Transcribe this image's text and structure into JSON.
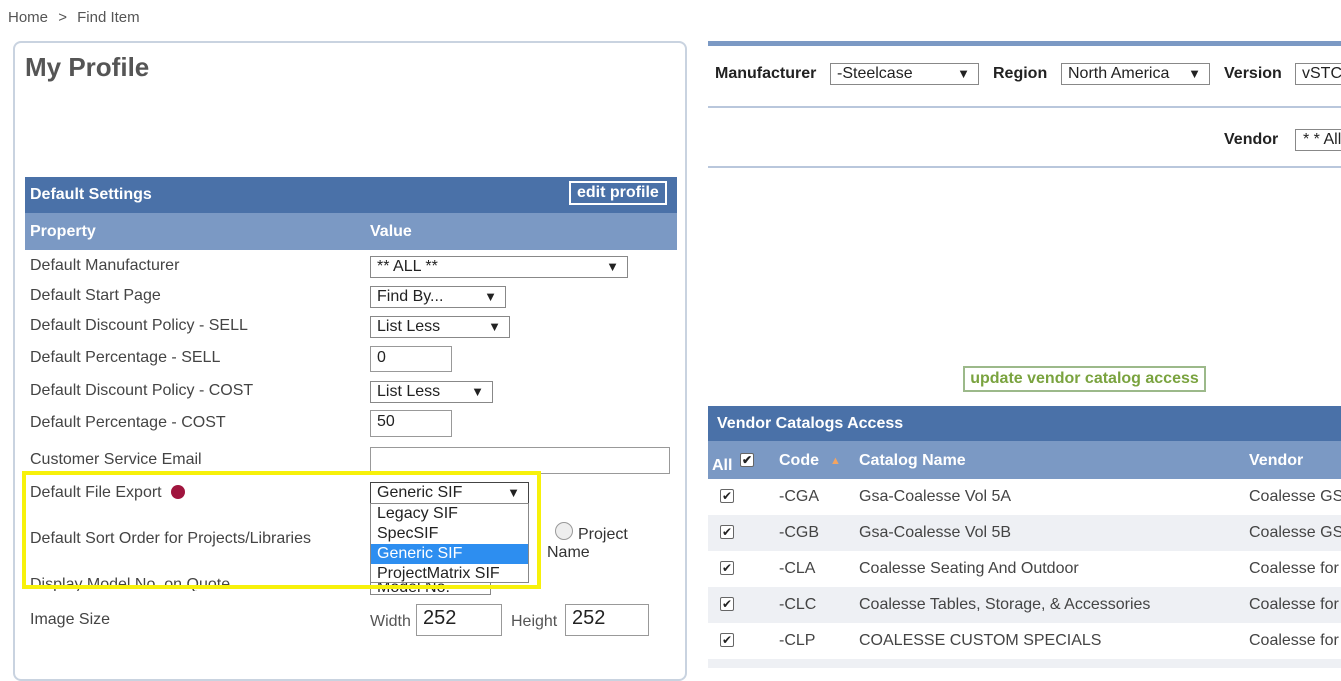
{
  "breadcrumb": {
    "home": "Home",
    "sep": ">",
    "current": "Find Item"
  },
  "profile": {
    "title": "My Profile",
    "section_title": "Default Settings",
    "edit_label": "edit profile",
    "col_property": "Property",
    "col_value": "Value",
    "rows": {
      "manufacturer": {
        "label": "Default Manufacturer",
        "value": "** ALL **"
      },
      "start_page": {
        "label": "Default Start Page",
        "value": "Find By..."
      },
      "discount_sell": {
        "label": "Default Discount Policy - SELL",
        "value": "List Less"
      },
      "percent_sell": {
        "label": "Default Percentage - SELL",
        "value": "0"
      },
      "discount_cost": {
        "label": "Default Discount Policy - COST",
        "value": "List Less"
      },
      "percent_cost": {
        "label": "Default Percentage - COST",
        "value": "50"
      },
      "cs_email": {
        "label": "Customer Service Email",
        "value": ""
      },
      "file_export": {
        "label": "Default File Export",
        "value": "Generic SIF"
      },
      "sort_order": {
        "label": "Default Sort Order for Projects/Libraries",
        "option_label": "Project Name"
      },
      "display_model": {
        "label": "Display Model No. on Quote",
        "value": "Model No."
      },
      "image_size": {
        "label": "Image Size",
        "width_label": "Width",
        "width": "252",
        "height_label": "Height",
        "height": "252"
      }
    },
    "file_export_options": [
      "Legacy SIF",
      "SpecSIF",
      "Generic SIF",
      "ProjectMatrix SIF"
    ],
    "file_export_selected": 2
  },
  "filters": {
    "manufacturer_label": "Manufacturer",
    "manufacturer_value": "-Steelcase",
    "region_label": "Region",
    "region_value": "North America",
    "version_label": "Version",
    "version_value": "vSTC",
    "vendor_label": "Vendor",
    "vendor_value": "* * All"
  },
  "update_label": "update vendor catalog access",
  "catalogs": {
    "title": "Vendor Catalogs Access",
    "col_all": "All",
    "col_code": "Code",
    "col_name": "Catalog Name",
    "col_vendor": "Vendor",
    "rows": [
      {
        "code": "-CGA",
        "name": "Gsa-Coalesse Vol 5A",
        "vendor": "Coalesse GS"
      },
      {
        "code": "-CGB",
        "name": "Gsa-Coalesse Vol 5B",
        "vendor": "Coalesse GS"
      },
      {
        "code": "-CLA",
        "name": "Coalesse Seating And Outdoor",
        "vendor": "Coalesse for"
      },
      {
        "code": "-CLC",
        "name": "Coalesse Tables, Storage, & Accessories",
        "vendor": "Coalesse for"
      },
      {
        "code": "-CLP",
        "name": "COALESSE CUSTOM SPECIALS",
        "vendor": "Coalesse for"
      }
    ]
  },
  "colors": {
    "header_blue": "#4a71a8",
    "subheader_blue": "#7b99c4",
    "highlight": "#f7f10a",
    "select_blue": "#2d8ef0",
    "update_green": "#7aa33f"
  }
}
